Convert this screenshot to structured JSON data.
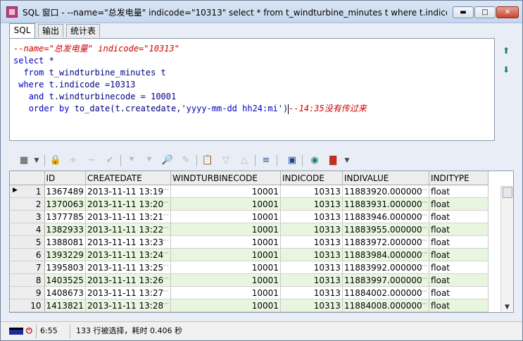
{
  "window": {
    "title": "SQL 窗口 - --name=\"总发电量\" indicode=\"10313\" select * from t_windturbine_minutes t where t.indicod...",
    "controls": {
      "minimize": "▬",
      "maximize": "□",
      "close": "✕"
    }
  },
  "tabs": [
    {
      "label": "SQL"
    },
    {
      "label": "输出"
    },
    {
      "label": "统计表"
    }
  ],
  "editor": {
    "line1_comment": "--name=\"总发电量\" indicode=\"10313\"",
    "line2_kw": "select",
    "line2_rest": " *",
    "line3_kw": "from",
    "line3_rest": " t_windturbine_minutes t",
    "line4_kw": "where",
    "line4_rest": " t.indicode =10313",
    "line5_kw": "and",
    "line5_rest": " t.windturbinecode = 10001",
    "line6_kw": "order by",
    "line6_fn": " to_date(t.createdate,",
    "line6_str": "'yyyy-mm-dd hh24:mi'",
    "line6_close": ")",
    "line6_comment": "--14:35没有传过来"
  },
  "grid": {
    "columns": [
      "ID",
      "CREATEDATE",
      "WINDTURBINECODE",
      "INDICODE",
      "INDIVALUE",
      "INDITYPE"
    ],
    "rows": [
      {
        "n": "1",
        "id": "1367489",
        "date": "2013-11-11 13:19",
        "wt": "10001",
        "ic": "10313",
        "val": "11883920.000000",
        "type": "float"
      },
      {
        "n": "2",
        "id": "1370063",
        "date": "2013-11-11 13:20",
        "wt": "10001",
        "ic": "10313",
        "val": "11883931.000000",
        "type": "float"
      },
      {
        "n": "3",
        "id": "1377785",
        "date": "2013-11-11 13:21",
        "wt": "10001",
        "ic": "10313",
        "val": "11883946.000000",
        "type": "float"
      },
      {
        "n": "4",
        "id": "1382933",
        "date": "2013-11-11 13:22",
        "wt": "10001",
        "ic": "10313",
        "val": "11883955.000000",
        "type": "float"
      },
      {
        "n": "5",
        "id": "1388081",
        "date": "2013-11-11 13:23",
        "wt": "10001",
        "ic": "10313",
        "val": "11883972.000000",
        "type": "float"
      },
      {
        "n": "6",
        "id": "1393229",
        "date": "2013-11-11 13:24",
        "wt": "10001",
        "ic": "10313",
        "val": "11883984.000000",
        "type": "float"
      },
      {
        "n": "7",
        "id": "1395803",
        "date": "2013-11-11 13:25",
        "wt": "10001",
        "ic": "10313",
        "val": "11883992.000000",
        "type": "float"
      },
      {
        "n": "8",
        "id": "1403525",
        "date": "2013-11-11 13:26",
        "wt": "10001",
        "ic": "10313",
        "val": "11883997.000000",
        "type": "float"
      },
      {
        "n": "9",
        "id": "1408673",
        "date": "2013-11-11 13:27",
        "wt": "10001",
        "ic": "10313",
        "val": "11884002.000000",
        "type": "float"
      },
      {
        "n": "10",
        "id": "1413821",
        "date": "2013-11-11 13:28",
        "wt": "10001",
        "ic": "10313",
        "val": "11884008.000000",
        "type": "float"
      }
    ]
  },
  "status": {
    "time": "6:55",
    "message": "133 行被选择，耗时 0.406 秒"
  },
  "colors": {
    "alt_row": "#e8f6e0",
    "keyword": "#0000c0",
    "comment": "#d00000"
  }
}
